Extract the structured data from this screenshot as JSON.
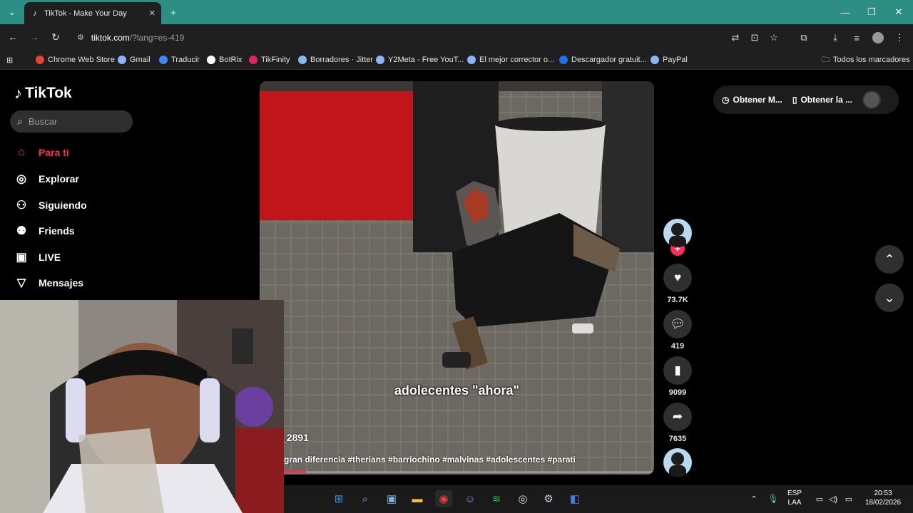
{
  "browser": {
    "tab_title": "TikTok - Make Your Day",
    "url_host": "tiktok.com",
    "url_rest": "/?lang=es-419",
    "bookmarks": [
      {
        "label": "Chrome Web Store",
        "color": "#e94235"
      },
      {
        "label": "Gmail",
        "color": "#8ab4f8"
      },
      {
        "label": "Traducir",
        "color": "#4285f4"
      },
      {
        "label": "BotRix",
        "color": "#ffffff"
      },
      {
        "label": "TikFinity",
        "color": "#e0245e"
      },
      {
        "label": "Borradores · Jitter",
        "color": "#8ab4f8"
      },
      {
        "label": "Y2Meta - Free YouT...",
        "color": "#8ab4f8"
      },
      {
        "label": "El mejor corrector o...",
        "color": "#8ab4f8"
      },
      {
        "label": "Descargador gratuit...",
        "color": "#1a73e8"
      },
      {
        "label": "PayPal",
        "color": "#8ab4f8"
      }
    ],
    "all_bookmarks": "Todos los marcadores"
  },
  "tiktok": {
    "brand": "TikTok",
    "search_placeholder": "Buscar",
    "nav": [
      {
        "label": "Para ti",
        "icon": "home-icon",
        "active": true
      },
      {
        "label": "Explorar",
        "icon": "compass-icon"
      },
      {
        "label": "Siguiendo",
        "icon": "user-follow-icon"
      },
      {
        "label": "Friends",
        "icon": "friends-icon"
      },
      {
        "label": "LIVE",
        "icon": "live-icon"
      },
      {
        "label": "Mensajes",
        "icon": "message-icon"
      }
    ],
    "top_actions": {
      "get_coins": "Obtener M...",
      "get_app": "Obtener la ..."
    },
    "video": {
      "caption": "adolecentes \"ahora\"",
      "username": "_2891",
      "description": "gran diferencia #therians #barriochino #malvinas #adolescentes #parati",
      "progress": 0.06
    },
    "actions": {
      "likes": "73.7K",
      "comments": "419",
      "saves": "9099",
      "shares": "7635"
    },
    "accent": "#fe2c55"
  },
  "taskbar": {
    "lang_top": "ESP",
    "lang_bottom": "LAA",
    "time": "20:53",
    "date": "18/02/2026"
  }
}
